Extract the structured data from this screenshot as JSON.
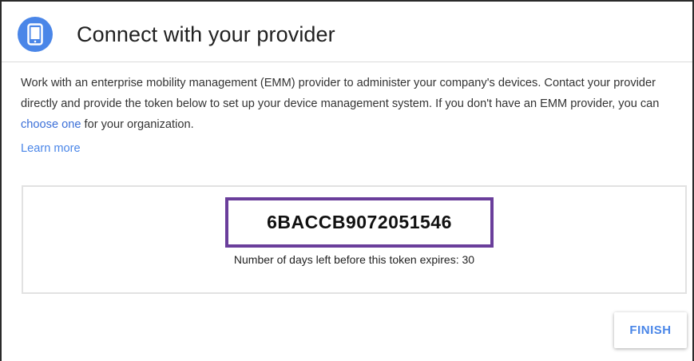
{
  "header": {
    "icon": "mobile-device-icon",
    "title": "Connect with your provider"
  },
  "description": {
    "part1": "Work with an enterprise mobility management (EMM) provider to administer your company's devices. Contact your provider directly and provide the token below to set up your device management system. If you don't have an EMM provider, you can ",
    "link": "choose one",
    "part2": " for your organization."
  },
  "learn_more": "Learn more",
  "token": {
    "value": "6BACCB9072051546",
    "expiry_text": "Number of days left before this token expires: 30"
  },
  "actions": {
    "finish_label": "FINISH"
  },
  "colors": {
    "accent": "#4a86e8",
    "token_border": "#6a3e9b"
  }
}
